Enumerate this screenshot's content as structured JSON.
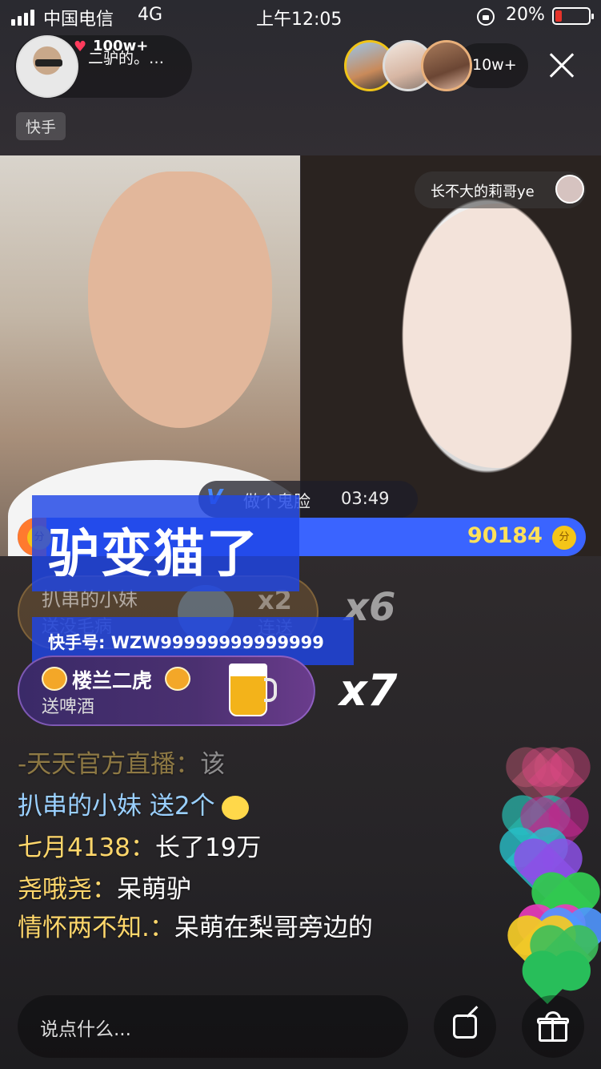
{
  "status_bar": {
    "carrier": "中国电信",
    "network": "4G",
    "time": "上午12:05",
    "battery_percent": "20%",
    "battery_level": 0.2,
    "battery_color": "#e6332a"
  },
  "anchor": {
    "name": "二驴的。…",
    "likes": "100w+",
    "heart_icon": "heart-icon"
  },
  "viewers": {
    "count": "10w+",
    "ring_color": "#f0c419"
  },
  "platform_tag": "快手",
  "pk": {
    "peer_name": "长不大的莉哥ye",
    "game_name": "做个鬼脸",
    "timer": "03:49",
    "score_right": "90184",
    "coin_label": "分",
    "left_share": 0.05,
    "left_color": "#ff7a2e",
    "right_color": "#3a64ff"
  },
  "watermark": {
    "title": "驴变猫了",
    "id_line": "快手号: WZW99999999999999"
  },
  "gifts": [
    {
      "user": "扒串的小妹",
      "desc": "送没毛病",
      "count": "x2",
      "sub": "连送",
      "combo": "x6",
      "icon": "bird-icon"
    },
    {
      "user": "楼兰二虎",
      "desc": "送啤酒",
      "combo": "x7",
      "icon": "beer-icon"
    }
  ],
  "chat": [
    {
      "user": "-天天官方直播：",
      "text": "该"
    },
    {
      "user": "扒串的小妹",
      "text": "送2个"
    },
    {
      "user": "七月4138：",
      "text": "长了19万"
    },
    {
      "user": "尧哦尧：",
      "text": "呆萌驴"
    },
    {
      "user": "情怀两不知.：",
      "text": "呆萌在梨哥旁边的"
    }
  ],
  "bottom": {
    "comment_placeholder": "说点什么...",
    "share_icon": "share-icon",
    "gift_icon": "gift-icon"
  }
}
